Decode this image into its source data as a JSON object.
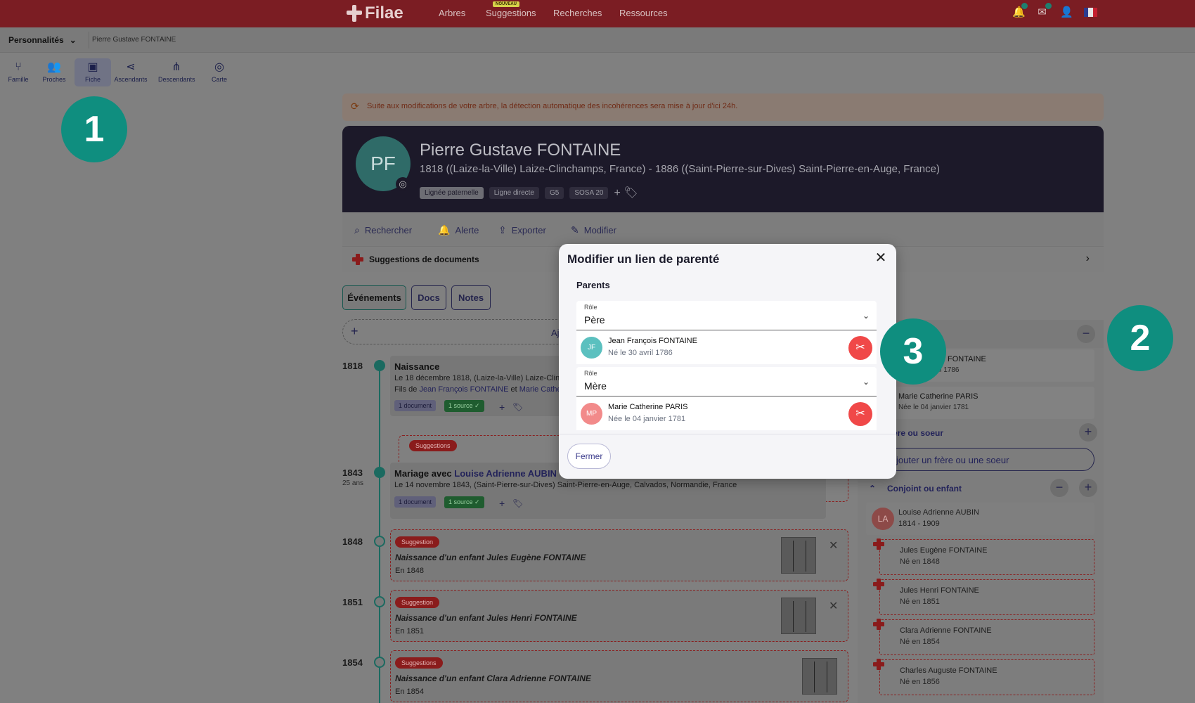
{
  "topnav": {
    "logo": "Filae",
    "items": [
      "Arbres",
      "Suggestions",
      "Recherches",
      "Ressources"
    ],
    "badge": "NOUVEAU",
    "icons": [
      "bell-icon",
      "mail-icon",
      "user-icon",
      "flag-fr-icon"
    ]
  },
  "breadcrumb": {
    "select": "Personnalités",
    "path": "Pierre Gustave FONTAINE"
  },
  "tools": [
    "Famille",
    "Proches",
    "Fiche",
    "Ascendants",
    "Descendants",
    "Carte"
  ],
  "steps": [
    "1",
    "2",
    "3"
  ],
  "notice": "Suite aux modifications de votre arbre, la détection automatique des incohérences sera mise à jour d'ici 24h.",
  "person": {
    "initials": "PF",
    "name": "Pierre Gustave FONTAINE",
    "dates": "1818 ((Laize-la-Ville) Laize-Clinchamps, France) - 1886 ((Saint-Pierre-sur-Dives) Saint-Pierre-en-Auge, France)",
    "tags": [
      "Lignée paternelle",
      "Ligne directe",
      "G5",
      "SOSA 20"
    ]
  },
  "actions": [
    "Rechercher",
    "Alerte",
    "Exporter",
    "Modifier"
  ],
  "suggestions_docs": "Suggestions de documents",
  "tabs": [
    "Événements",
    "Docs",
    "Notes"
  ],
  "add_row_text": "Aj",
  "timeline": {
    "e1": {
      "year": "1818",
      "title": "Naissance",
      "line1": "Le 18 décembre 1818, (Laize-la-Ville) Laize-Clin",
      "line2_prefix": "Fils de ",
      "father": "Jean François FONTAINE",
      "and": " et ",
      "mother": "Marie Cathe",
      "doc": "1 document",
      "src": "1 source ✓"
    },
    "suggestions_pill": "Suggestions",
    "e2": {
      "year": "1843",
      "age": "25 ans",
      "title_prefix": "Mariage avec ",
      "spouse": "Louise Adrienne AUBIN",
      "line1": "Le 14 novembre 1843, (Saint-Pierre-sur-Dives) Saint-Pierre-en-Auge, Calvados, Normandie, France",
      "doc": "1 document",
      "src": "1 source ✓"
    },
    "s1": {
      "year": "1848",
      "pill": "Suggestion",
      "title": "Naissance d'un enfant Jules Eugène FONTAINE",
      "sub": "En 1848"
    },
    "s2": {
      "year": "1851",
      "pill": "Suggestion",
      "title": "Naissance d'un enfant Jules Henri FONTAINE",
      "sub": "En 1851"
    },
    "s3": {
      "year": "1854",
      "pill": "Suggestions",
      "title": "Naissance d'un enfant Clara Adrienne FONTAINE",
      "sub": "En 1854"
    }
  },
  "sidebar": {
    "father_name": "FONTAINE",
    "father_date": "il 1786",
    "mother_name": "Marie Catherine PARIS",
    "mother_date": "Née le 04 janvier 1781",
    "siblings_label": "ère ou soeur",
    "add_sibling": "jouter un frère ou une soeur",
    "spouse_label": "Conjoint ou enfant",
    "spouse": {
      "initials": "LA",
      "name": "Louise Adrienne AUBIN",
      "dates": "1814 - 1909"
    },
    "children": [
      {
        "name": "Jules Eugène FONTAINE",
        "date": "Né en 1848"
      },
      {
        "name": "Jules Henri FONTAINE",
        "date": "Né en 1851"
      },
      {
        "name": "Clara Adrienne FONTAINE",
        "date": "Né en 1854"
      },
      {
        "name": "Charles Auguste FONTAINE",
        "date": "Né en 1856"
      }
    ]
  },
  "modal": {
    "title": "Modifier un lien de parenté",
    "section": "Parents",
    "role_label": "Rôle",
    "father_role": "Père",
    "mother_role": "Mère",
    "father": {
      "initials": "JF",
      "name": "Jean François FONTAINE",
      "date": "Né le 30 avril 1786",
      "color": "#5bc0bf"
    },
    "mother": {
      "initials": "MP",
      "name": "Marie Catherine PARIS",
      "date": "Née le 04 janvier 1781",
      "color": "#f28a8a"
    },
    "close_label": "Fermer"
  }
}
